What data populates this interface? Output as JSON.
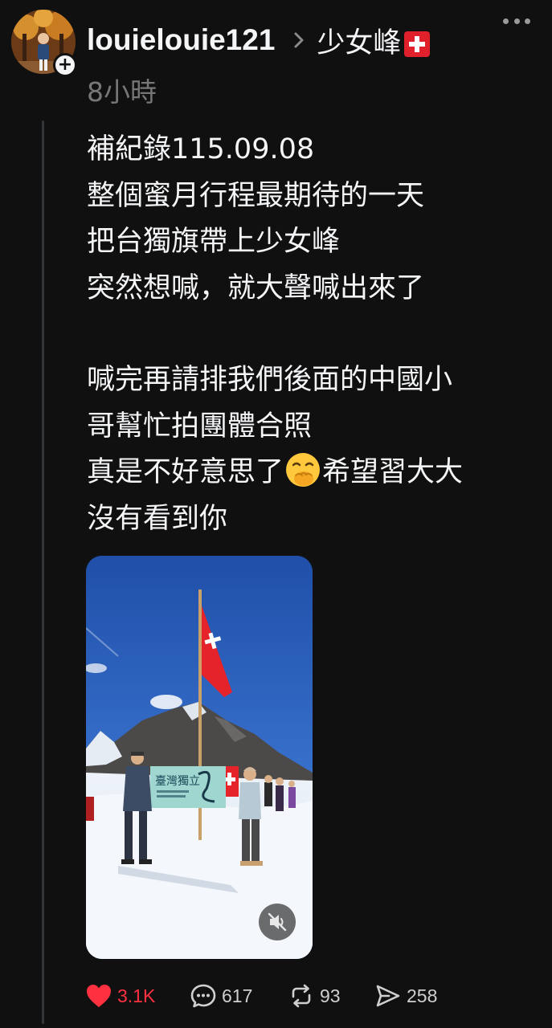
{
  "post": {
    "author": {
      "username": "louielouie121",
      "avatar_icon": "avatar-photo",
      "follow_icon": "plus-icon"
    },
    "topic": {
      "label": "少女峰",
      "flag_icon": "swiss-flag-icon"
    },
    "timestamp": "8小時",
    "text_lines": [
      "補紀錄115.09.08",
      "整個蜜月行程最期待的一天",
      "把台獨旗帶上少女峰",
      "突然想喊，就大聲喊出來了",
      "",
      "喊完再請排我們後面的中國小",
      "哥幫忙拍團體合照",
      "真是不好意思了",
      "希望習大大",
      "沒有看到你"
    ],
    "emoji_icon": "hand-over-mouth-emoji",
    "media": {
      "type": "video",
      "banner_text": "臺灣獨立",
      "mute_icon": "speaker-muted-icon"
    },
    "actions": {
      "likes": "3.1K",
      "replies": "617",
      "reposts": "93",
      "shares": "258"
    },
    "colors": {
      "background": "#101010",
      "text": "#f3f5f7",
      "secondary": "#777777",
      "like": "#ff3040"
    }
  }
}
